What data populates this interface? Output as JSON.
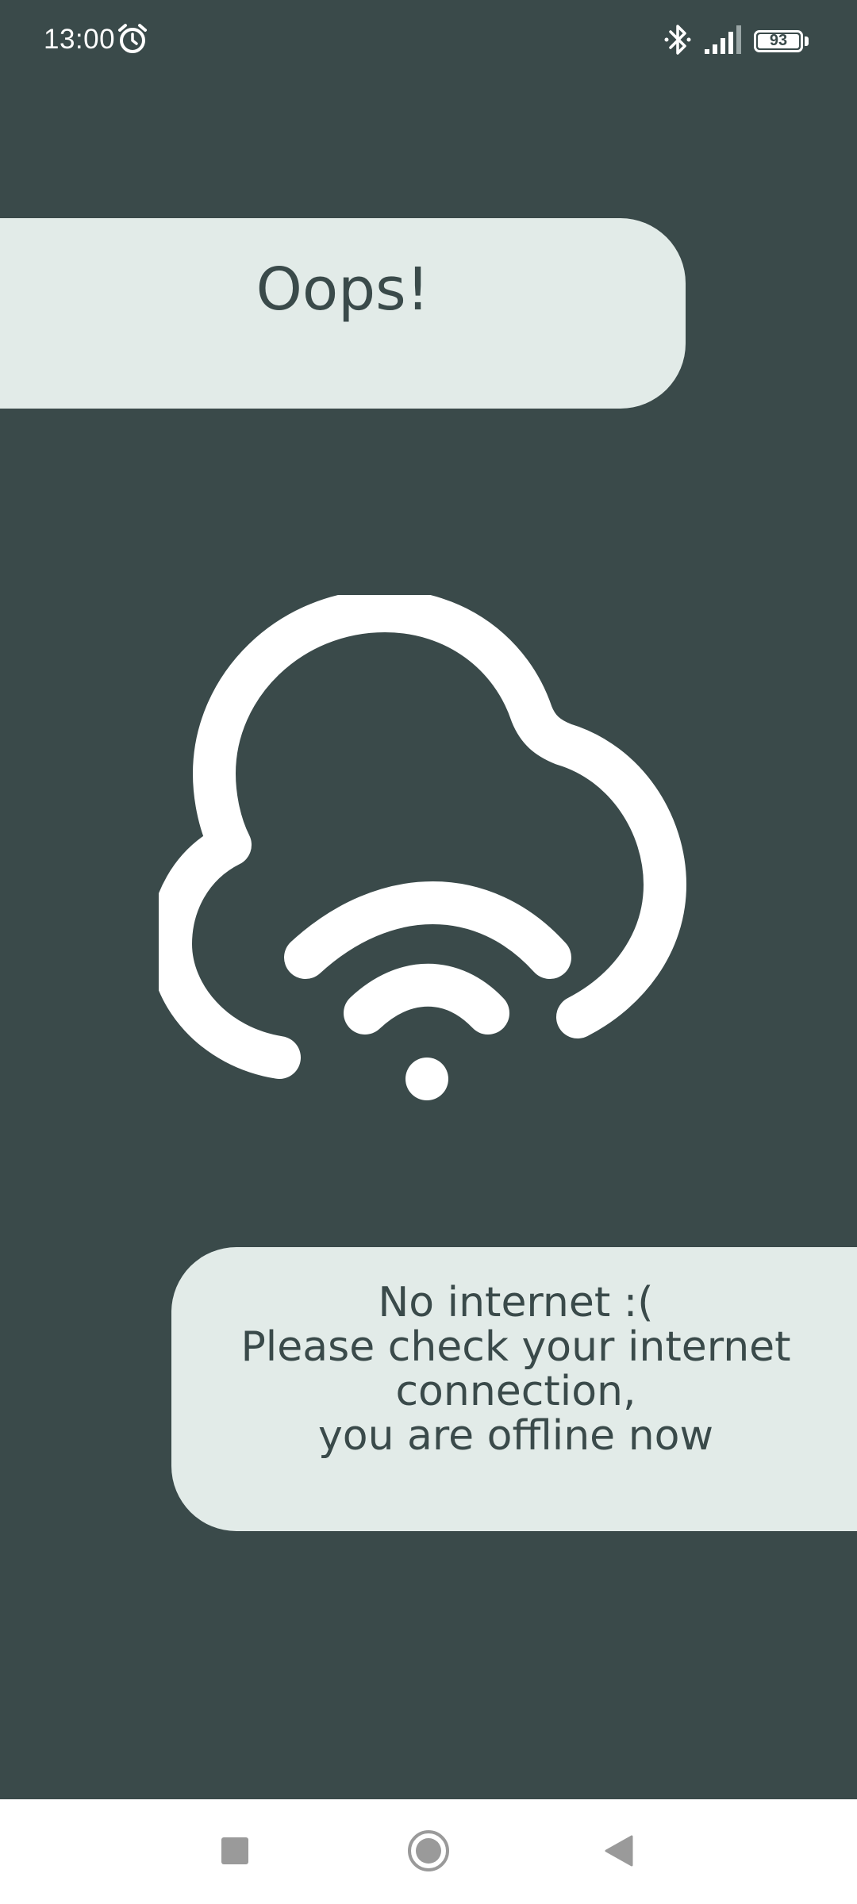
{
  "status_bar": {
    "time": "13:00",
    "battery_level": "93",
    "icons": [
      "alarm-icon",
      "bluetooth-icon",
      "signal-icon",
      "battery-icon"
    ]
  },
  "header": {
    "title": "Oops!"
  },
  "illustration": {
    "icon": "cloud-wifi-off-icon"
  },
  "message": {
    "lines": [
      "No internet :(",
      "Please check your internet",
      "connection,",
      "you are offline now"
    ]
  },
  "nav_bar": {
    "icons": [
      "recents-square-icon",
      "home-circle-icon",
      "back-triangle-icon"
    ]
  },
  "colors": {
    "background": "#3a4a4a",
    "card": "#e2ebe8",
    "text": "#3a4a4a",
    "icon": "#ffffff"
  }
}
